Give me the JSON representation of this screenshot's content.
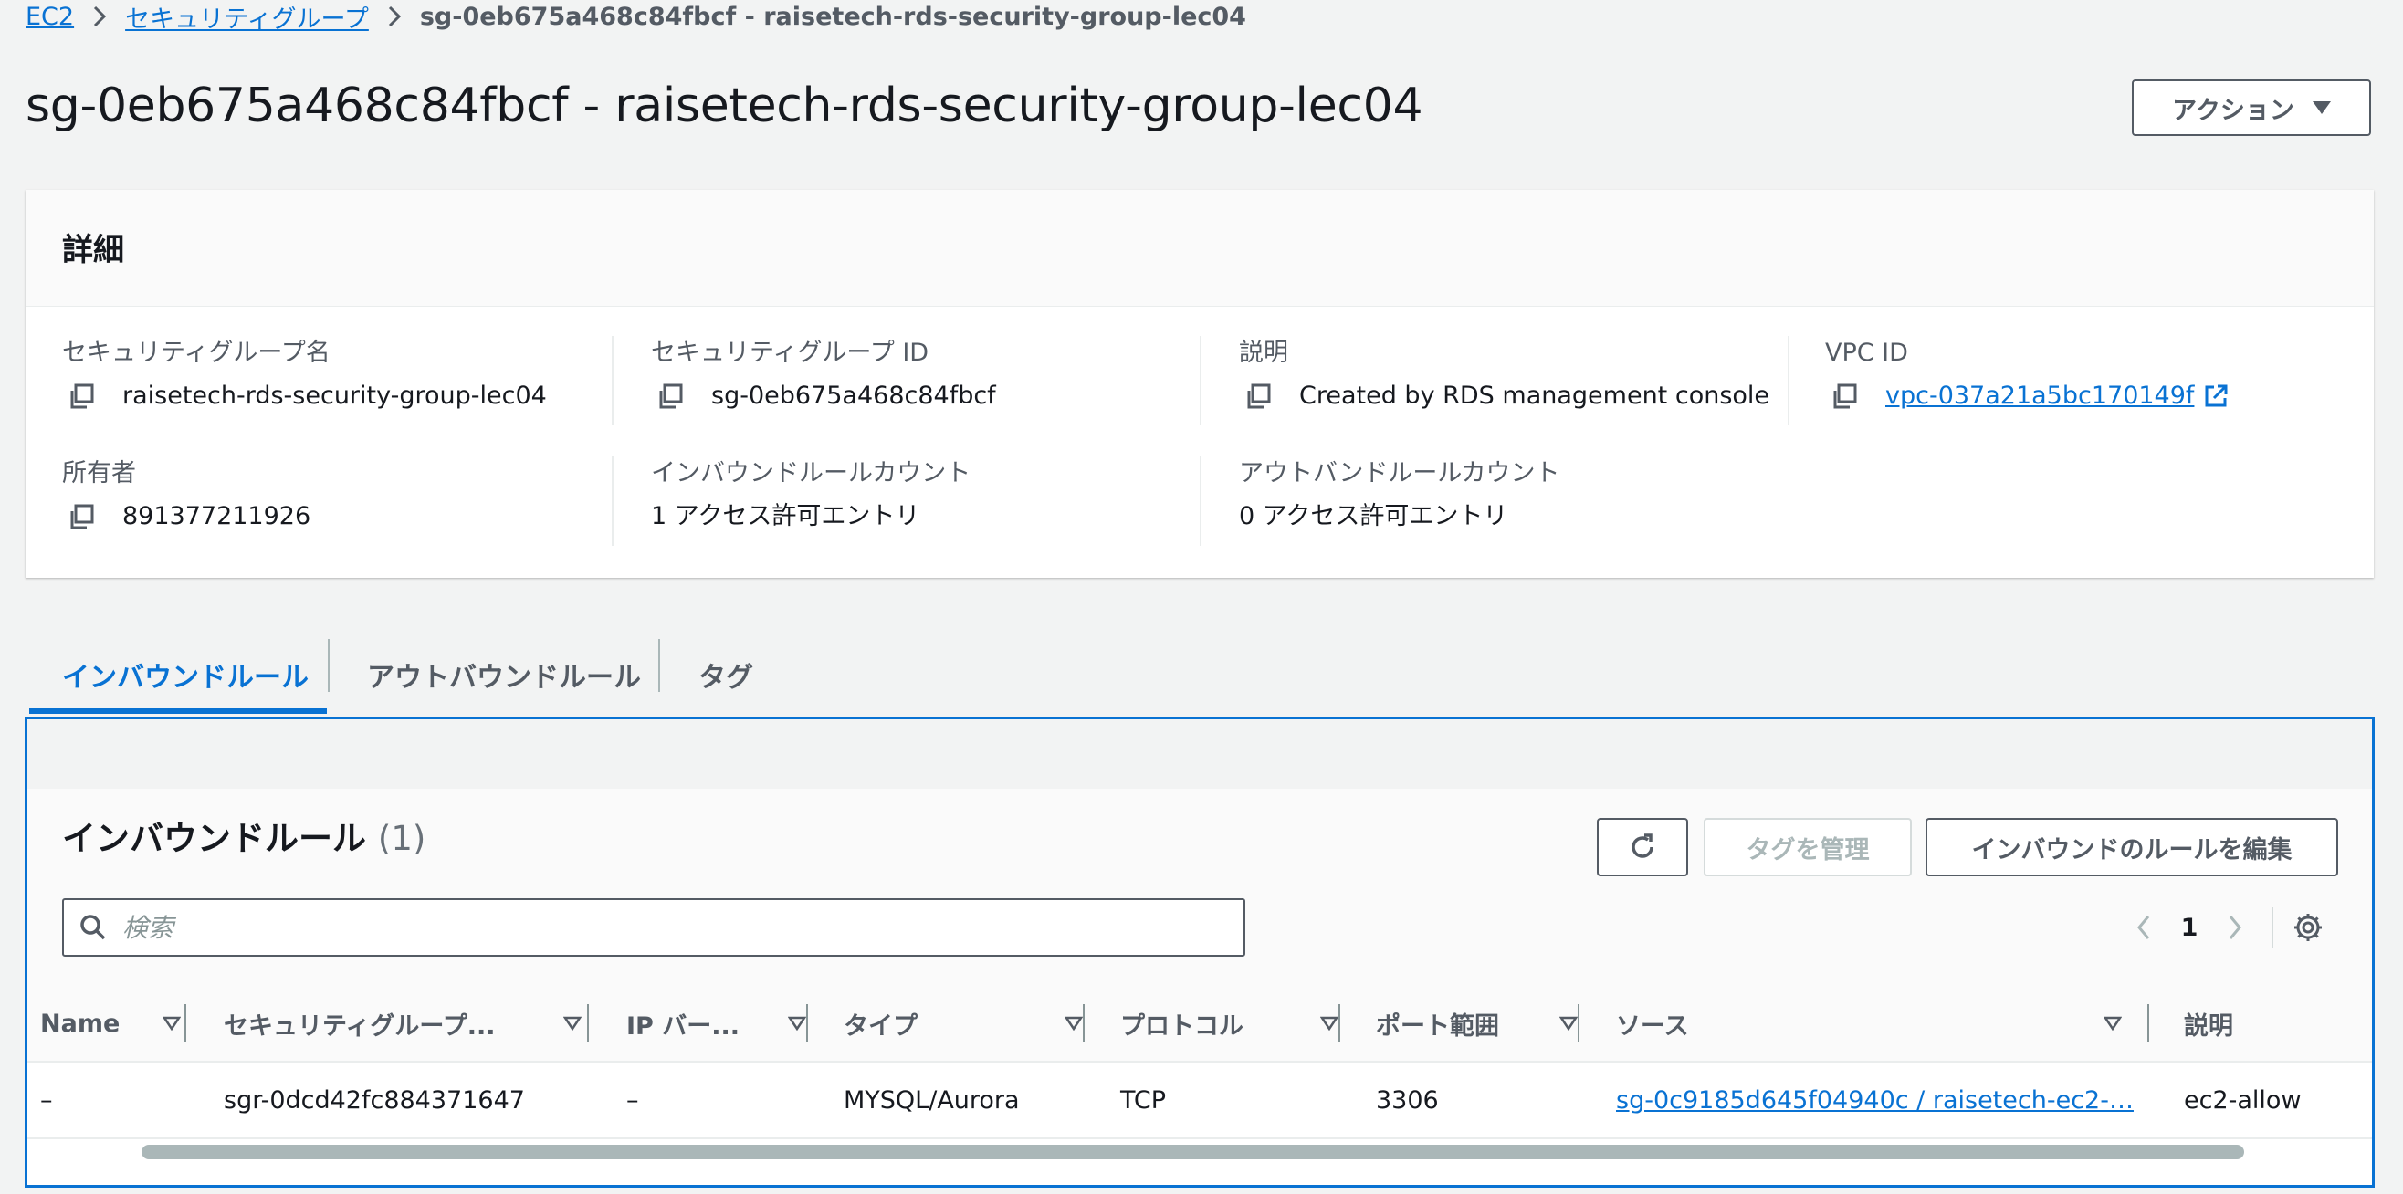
{
  "breadcrumb": {
    "items": [
      {
        "label": "EC2"
      },
      {
        "label": "セキュリティグループ"
      }
    ],
    "current": "sg-0eb675a468c84fbcf - raisetech-rds-security-group-lec04"
  },
  "page_title": "sg-0eb675a468c84fbcf - raisetech-rds-security-group-lec04",
  "actions_button": "アクション",
  "details": {
    "title": "詳細",
    "fields": {
      "sg_name": {
        "label": "セキュリティグループ名",
        "value": "raisetech-rds-security-group-lec04"
      },
      "sg_id": {
        "label": "セキュリティグループ ID",
        "value": "sg-0eb675a468c84fbcf"
      },
      "description": {
        "label": "説明",
        "value": "Created by RDS management console"
      },
      "vpc_id": {
        "label": "VPC ID",
        "value": "vpc-037a21a5bc170149f"
      },
      "owner": {
        "label": "所有者",
        "value": "891377211926"
      },
      "inbound_count": {
        "label": "インバウンドルールカウント",
        "value": "1 アクセス許可エントリ"
      },
      "outbound_count": {
        "label": "アウトバンドルールカウント",
        "value": "0 アクセス許可エントリ"
      }
    }
  },
  "tabs": [
    {
      "label": "インバウンドルール",
      "active": true
    },
    {
      "label": "アウトバウンドルール",
      "active": false
    },
    {
      "label": "タグ",
      "active": false
    }
  ],
  "inbound": {
    "title": "インバウンドルール",
    "count": "(1)",
    "manage_tags_button": "タグを管理",
    "edit_button": "インバウンドのルールを編集",
    "search_placeholder": "検索",
    "page_number": "1",
    "columns": [
      "Name",
      "セキュリティグループ...",
      "IP バー...",
      "タイプ",
      "プロトコル",
      "ポート範囲",
      "ソース",
      "説明"
    ],
    "rows": [
      {
        "name": "–",
        "rule_id": "sgr-0dcd42fc884371647",
        "ip_version": "–",
        "type": "MYSQL/Aurora",
        "protocol": "TCP",
        "port_range": "3306",
        "source": "sg-0c9185d645f04940c / raisetech-ec2-…",
        "description": "ec2-allow"
      }
    ]
  },
  "colors": {
    "link": "#0972d3",
    "text": "#16191f",
    "secondary_text": "#545b64",
    "background": "#f2f3f3"
  }
}
